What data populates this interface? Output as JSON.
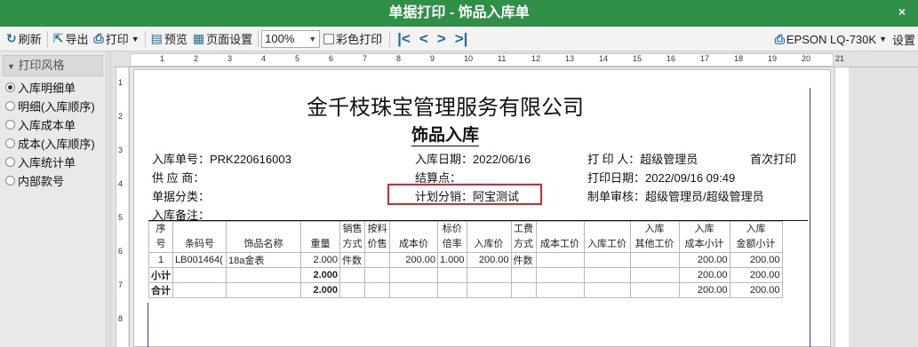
{
  "window": {
    "title": "单据打印 - 饰品入库单",
    "close": "×"
  },
  "toolbar": {
    "refresh": "刷新",
    "export": "导出",
    "print": "打印",
    "preview": "预览",
    "page_setup": "页面设置",
    "zoom": "100%",
    "color_print": "彩色打印",
    "printer": "EPSON LQ-730K",
    "settings": "设置"
  },
  "sidebar": {
    "header": "打印风格",
    "items": [
      {
        "label": "入库明细单",
        "selected": true
      },
      {
        "label": "明细(入库顺序)",
        "selected": false
      },
      {
        "label": "入库成本单",
        "selected": false
      },
      {
        "label": "成本(入库顺序)",
        "selected": false
      },
      {
        "label": "入库统计单",
        "selected": false
      },
      {
        "label": "内部款号",
        "selected": false
      }
    ]
  },
  "ruler": {
    "top": [
      "1",
      "2",
      "3",
      "4",
      "5",
      "6",
      "7",
      "8",
      "9",
      "10",
      "11",
      "12",
      "13",
      "14",
      "15",
      "16",
      "17",
      "18",
      "19",
      "20",
      "21"
    ],
    "left": [
      "1",
      "2",
      "3",
      "4",
      "5",
      "6",
      "7",
      "8"
    ]
  },
  "document": {
    "company": "金千枝珠宝管理服务有限公司",
    "title": "饰品入库",
    "fields": {
      "order_no": "入库单号：PRK220616003",
      "in_date": "入库日期：2022/06/16",
      "printer": "打 印 人：超级管理员",
      "first_print": "首次打印",
      "supplier": "供 应 商：",
      "settle": "结算点：",
      "print_date": "打印日期：2022/09/16 09:49",
      "category": "单据分类：",
      "plan": "计划分销：阿宝测试",
      "reviewer": "制单审核：超级管理员/超级管理员",
      "remark": "入库备注："
    },
    "table": {
      "headers_top": [
        "序",
        "",
        "",
        "",
        "销售",
        "按料",
        "",
        "标价",
        "",
        "工费",
        "",
        "",
        "入库",
        "入库",
        "入库"
      ],
      "headers_bottom": [
        "号",
        "条码号",
        "饰品名称",
        "重量",
        "方式",
        "价售",
        "成本价",
        "倍率",
        "入库价",
        "方式",
        "成本工价",
        "入库工价",
        "其他工价",
        "成本小计",
        "金额小计"
      ],
      "rows": [
        [
          "1",
          "LB001464(",
          "18a金表",
          "2.000",
          "件数",
          "",
          "200.00",
          "1.000",
          "200.00",
          "件数",
          "",
          "",
          "",
          "200.00",
          "200.00"
        ],
        [
          "小计",
          "",
          "",
          "2.000",
          "",
          "",
          "",
          "",
          "",
          "",
          "",
          "",
          "",
          "200.00",
          "200.00"
        ],
        [
          "合计",
          "",
          "",
          "2.000",
          "",
          "",
          "",
          "",
          "",
          "",
          "",
          "",
          "",
          "200.00",
          "200.00"
        ]
      ]
    }
  }
}
